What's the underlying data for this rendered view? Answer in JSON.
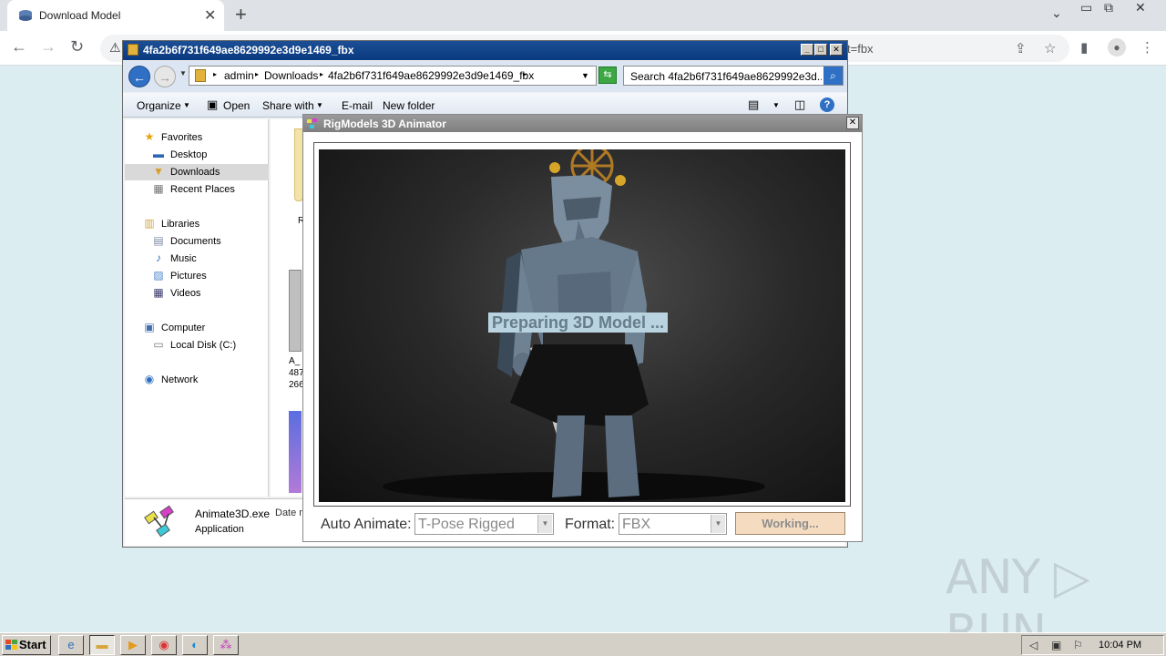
{
  "browser": {
    "tab_title": "Download Model",
    "tab_close": "✕",
    "new_tab": "+",
    "url_visible_fragment": "t=fbx",
    "win_controls": [
      "⌄",
      "▭",
      "⧉",
      "✕"
    ]
  },
  "explorer": {
    "title": "4fa2b6f731f649ae8629992e3d9e1469_fbx",
    "breadcrumbs": [
      "admin",
      "Downloads",
      "4fa2b6f731f649ae8629992e3d9e1469_fbx"
    ],
    "search_placeholder": "Search 4fa2b6f731f649ae8629992e3d...",
    "toolbar": {
      "organize": "Organize",
      "open": "Open",
      "share_with": "Share with",
      "email": "E-mail",
      "new_folder": "New folder"
    },
    "nav": {
      "favorites": "Favorites",
      "desktop": "Desktop",
      "downloads": "Downloads",
      "recent_places": "Recent Places",
      "libraries": "Libraries",
      "documents": "Documents",
      "music": "Music",
      "pictures": "Pictures",
      "videos": "Videos",
      "computer": "Computer",
      "local_disk": "Local Disk (C:)",
      "network": "Network"
    },
    "content_fragments": {
      "f1": "R",
      "f2a": "A_",
      "f2b": "487",
      "f2c": "266"
    },
    "details": {
      "name": "Animate3D.exe",
      "date": "Date m",
      "type": "Application"
    }
  },
  "rig": {
    "title": "RigModels 3D Animator",
    "status": "Preparing 3D Model ...",
    "auto_animate_label": "Auto Animate:",
    "auto_animate_value": "T-Pose Rigged",
    "format_label": "Format:",
    "format_value": "FBX",
    "working_button": "Working..."
  },
  "watermark": "ANY ▷ RUN",
  "taskbar": {
    "start": "Start",
    "clock": "10:04 PM"
  },
  "colors": {
    "explorer_title": "#0a3a80",
    "rig_title": "#8a8a8a",
    "status_bg": "#b9d3e0",
    "working_bg": "#f5dcc0",
    "desktop_bg": "#dcedf2"
  }
}
